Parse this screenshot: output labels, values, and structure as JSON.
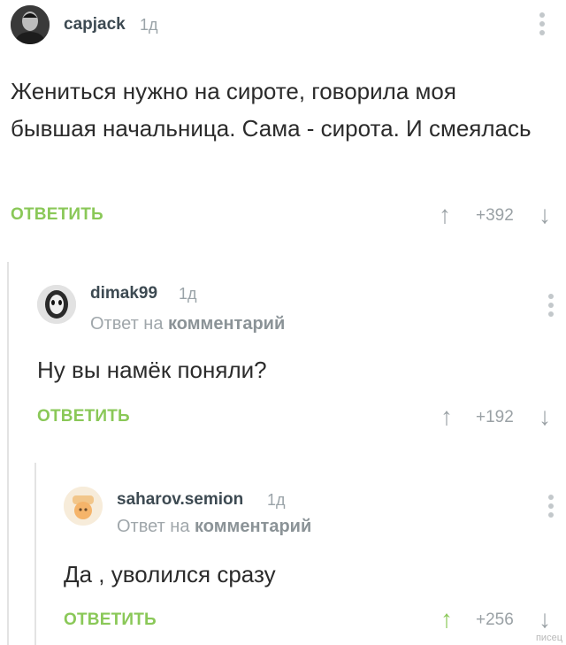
{
  "comments": [
    {
      "username": "capjack",
      "time": "1д",
      "text": "Жениться нужно на сироте, говорила моя бывшая начальница. Сама - сирота. И смеялась",
      "reply_label": "ОТВЕТИТЬ",
      "rating": "+392",
      "upvoted": false
    },
    {
      "username": "dimak99",
      "time": "1д",
      "reply_prefix": "Ответ на",
      "reply_target": "комментарий",
      "text": "Ну вы намёк поняли?",
      "reply_label": "ОТВЕТИТЬ",
      "rating": "+192",
      "upvoted": false
    },
    {
      "username": "saharov.semion",
      "time": "1д",
      "reply_prefix": "Ответ на",
      "reply_target": "комментарий",
      "text": "Да , уволился сразу",
      "reply_label": "ОТВЕТИТЬ",
      "rating": "+256",
      "upvoted": true
    }
  ],
  "icons": {
    "upvote": "arrow-up-icon",
    "downvote": "arrow-down-icon",
    "more": "more-vertical-icon"
  },
  "colors": {
    "accent": "#8ac858",
    "muted": "#9aa1a5"
  },
  "watermark": "писец"
}
